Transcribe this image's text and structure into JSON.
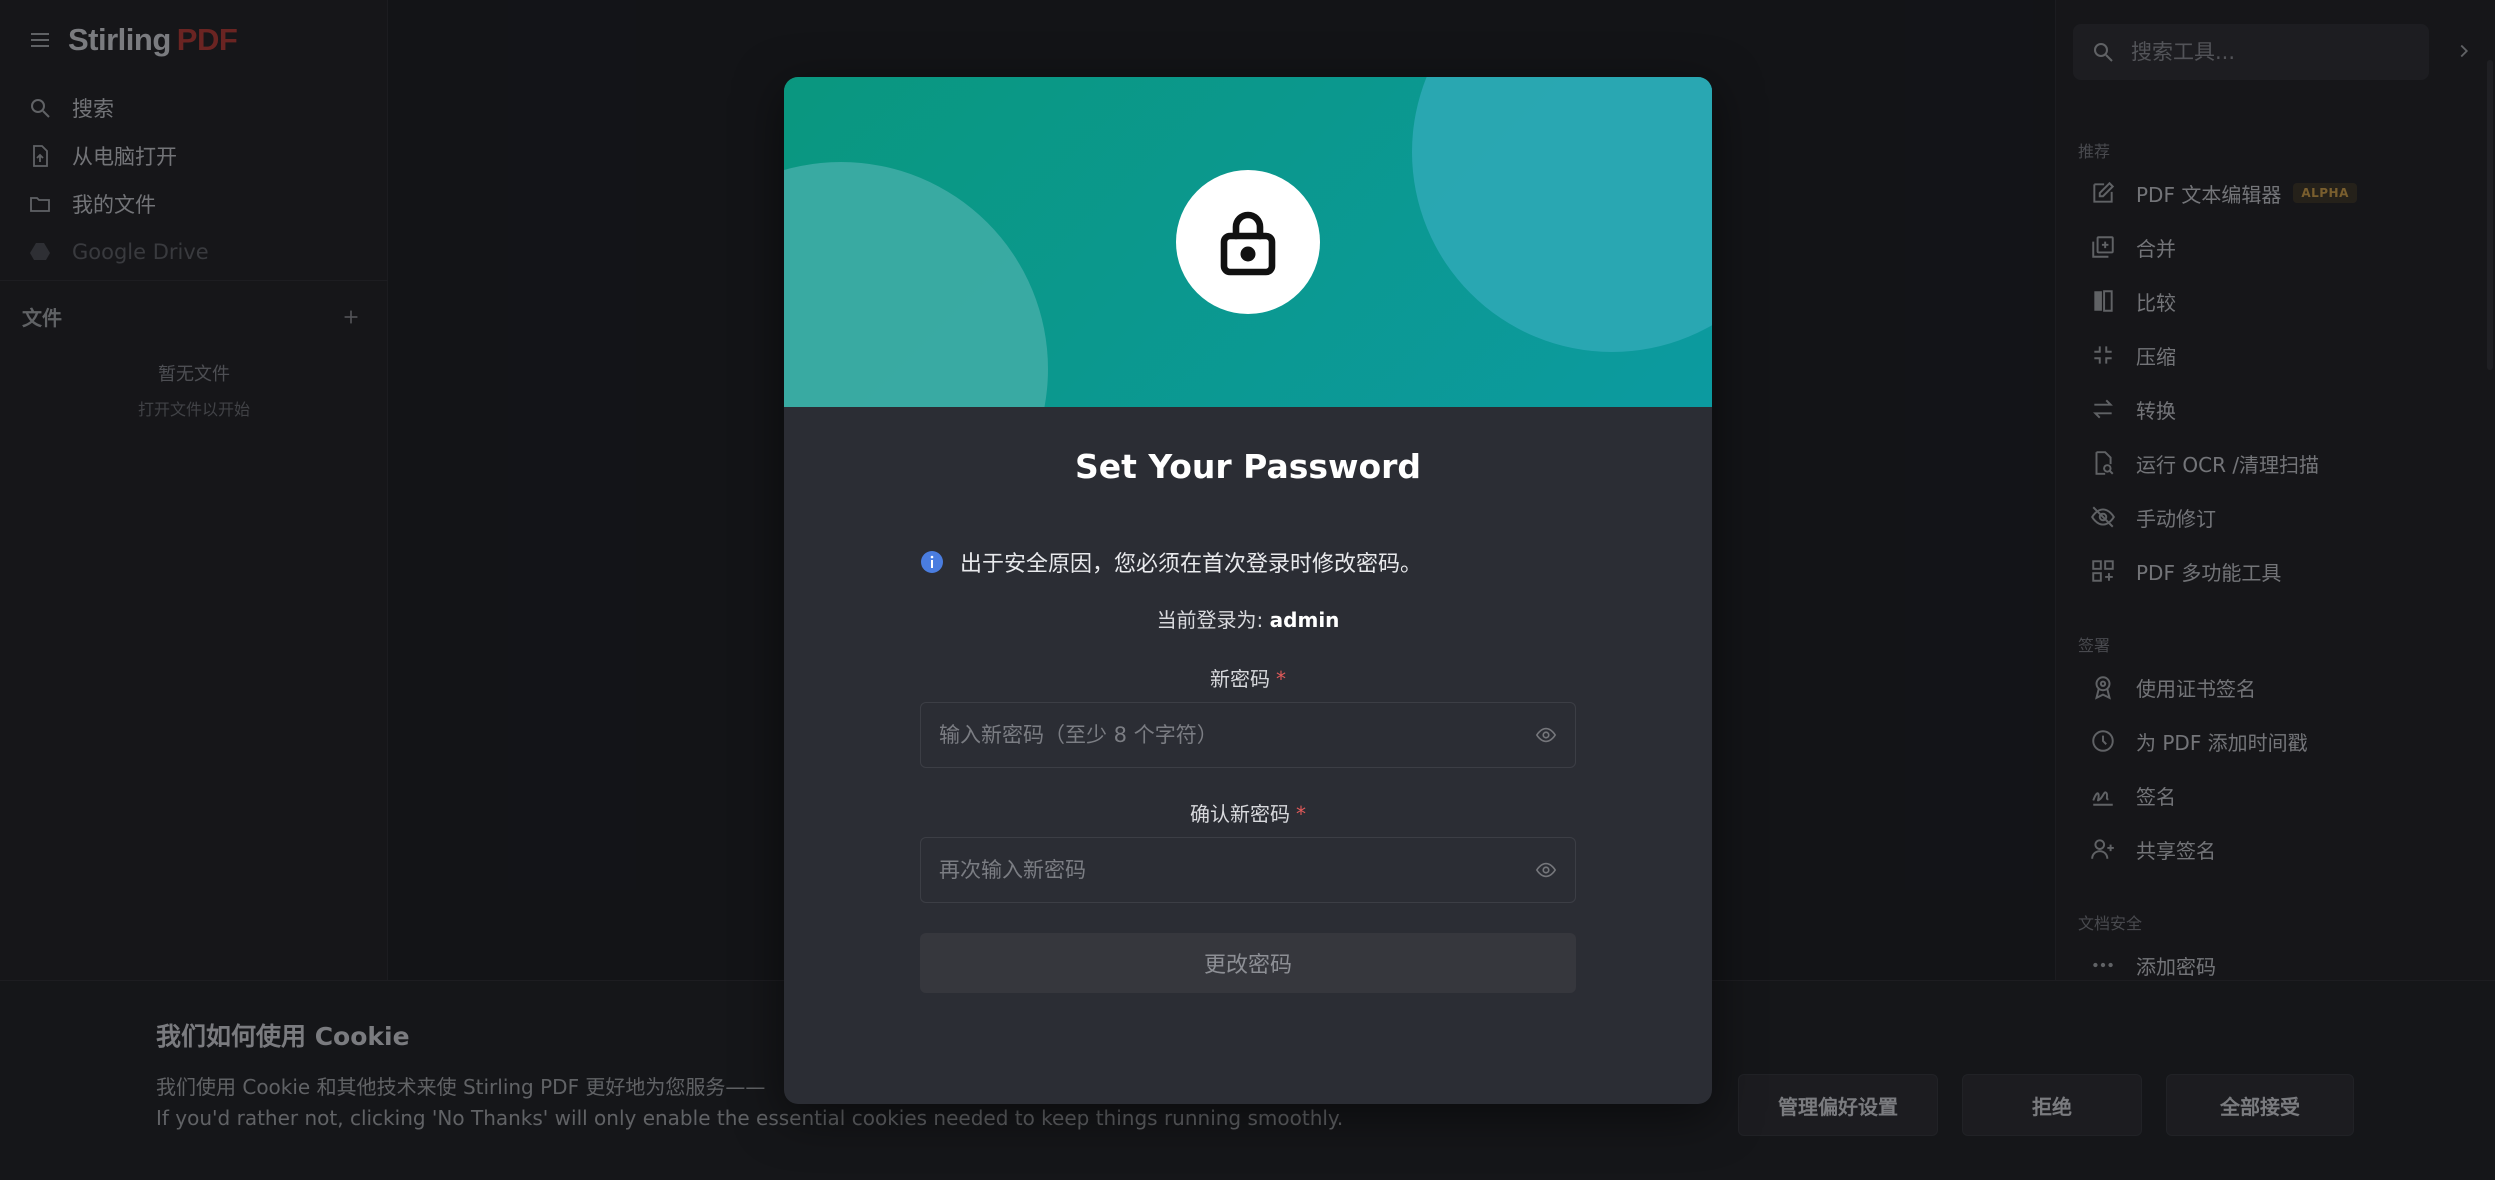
{
  "brand": {
    "name_a": "Stirling",
    "name_b": "PDF"
  },
  "left_nav": [
    {
      "label": "搜索",
      "icon": "search-icon"
    },
    {
      "label": "从电脑打开",
      "icon": "upload-file-icon"
    },
    {
      "label": "我的文件",
      "icon": "folder-icon"
    },
    {
      "label": "Google Drive",
      "icon": "google-drive-icon"
    }
  ],
  "files": {
    "header": "文件",
    "empty_title": "暂无文件",
    "empty_sub": "打开文件以开始"
  },
  "tool_search": {
    "placeholder": "搜索工具..."
  },
  "tools": {
    "recommended_label": "推荐",
    "recommended": [
      {
        "label": "PDF 文本编辑器",
        "badge": "ALPHA",
        "icon": "edit-icon"
      },
      {
        "label": "合并",
        "icon": "add-box-icon"
      },
      {
        "label": "比较",
        "icon": "compare-icon"
      },
      {
        "label": "压缩",
        "icon": "compress-icon"
      },
      {
        "label": "转换",
        "icon": "swap-icon"
      },
      {
        "label": "运行 OCR /清理扫描",
        "icon": "scan-search-icon"
      },
      {
        "label": "手动修订",
        "icon": "eye-off-icon"
      },
      {
        "label": "PDF 多功能工具",
        "icon": "grid-icon"
      }
    ],
    "sign_label": "签署",
    "sign": [
      {
        "label": "使用证书签名",
        "icon": "certificate-icon"
      },
      {
        "label": "为 PDF 添加时间戳",
        "icon": "clock-icon"
      },
      {
        "label": "签名",
        "icon": "signature-icon"
      },
      {
        "label": "共享签名",
        "icon": "user-add-icon"
      }
    ],
    "security_label": "文档安全",
    "security": [
      {
        "label": "添加密码",
        "icon": "more-icon"
      }
    ]
  },
  "modal": {
    "title": "Set Your Password",
    "notice": "出于安全原因，您必须在首次登录时修改密码。",
    "logged_in_prefix": "当前登录为: ",
    "username": "admin",
    "new_password_label": "新密码",
    "new_password_placeholder": "输入新密码（至少 8 个字符）",
    "confirm_label": "确认新密码",
    "confirm_placeholder": "再次输入新密码",
    "required_mark": "*",
    "submit_label": "更改密码"
  },
  "cookie": {
    "title": "我们如何使用 Cookie",
    "line1": "我们使用 Cookie 和其他技术来使 Stirling PDF 更好地为您服务——",
    "line2": "If you'd rather not, clicking 'No Thanks' will only enable the essential cookies needed to keep things running smoothly.",
    "manage_label": "管理偏好设置",
    "reject_label": "拒绝",
    "accept_label": "全部接受"
  },
  "colors": {
    "accent_teal": "#0a977f",
    "brand_red": "#b83a34",
    "info_blue": "#4a7de0",
    "required_red": "#e05a5a"
  }
}
